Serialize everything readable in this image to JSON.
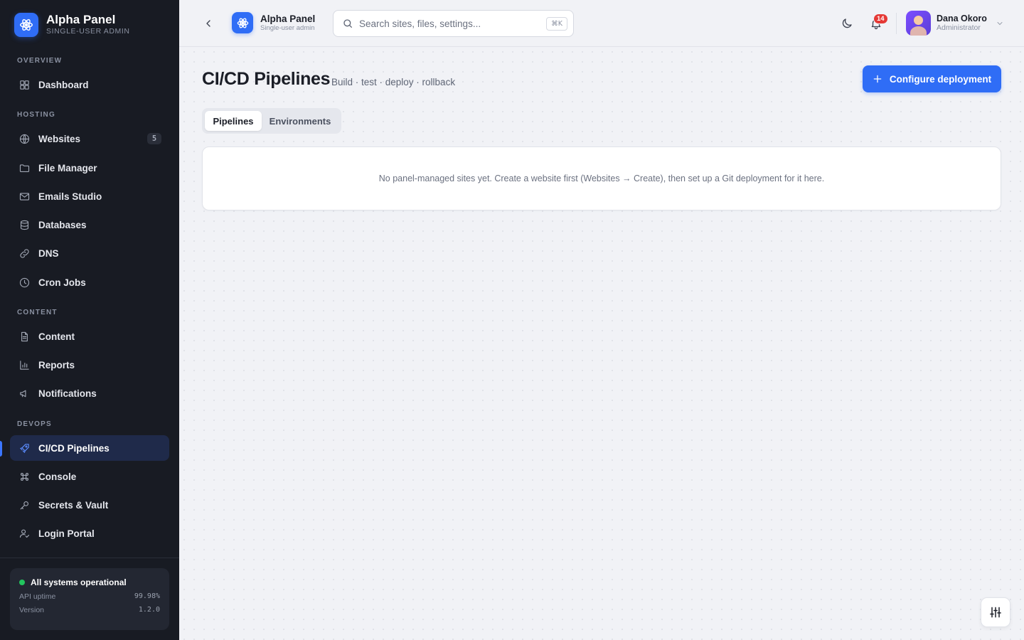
{
  "brand": {
    "title": "Alpha Panel",
    "subtitle": "SINGLE-USER ADMIN",
    "top_title": "Alpha Panel",
    "top_subtitle": "Single-user admin",
    "accent": "#2f6df6"
  },
  "sidebar": {
    "sections": {
      "overview": "OVERVIEW",
      "hosting": "HOSTING",
      "content": "CONTENT",
      "devops": "DEVOPS"
    },
    "items": [
      {
        "label": "Dashboard",
        "icon": "dashboard-icon"
      },
      {
        "label": "Websites",
        "icon": "globe-icon",
        "count": "5"
      },
      {
        "label": "File Manager",
        "icon": "folder-icon"
      },
      {
        "label": "Emails Studio",
        "icon": "mail-icon"
      },
      {
        "label": "Databases",
        "icon": "database-icon"
      },
      {
        "label": "DNS",
        "icon": "link-icon"
      },
      {
        "label": "Cron Jobs",
        "icon": "clock-icon"
      },
      {
        "label": "Content",
        "icon": "document-icon"
      },
      {
        "label": "Reports",
        "icon": "bar-chart-icon"
      },
      {
        "label": "Notifications",
        "icon": "megaphone-icon"
      },
      {
        "label": "CI/CD Pipelines",
        "icon": "rocket-icon",
        "active": true
      },
      {
        "label": "Console",
        "icon": "command-icon"
      },
      {
        "label": "Secrets & Vault",
        "icon": "key-icon"
      },
      {
        "label": "Login Portal",
        "icon": "user-check-icon"
      }
    ],
    "status": {
      "headline": "All systems operational",
      "uptime_label": "API uptime",
      "uptime_value": "99.98%",
      "version_label": "Version",
      "version_value": "1.2.0",
      "color": "#22c55e"
    }
  },
  "topbar": {
    "search_placeholder": "Search sites, files, settings...",
    "search_shortcut": "⌘K",
    "notifications_count": "14",
    "user": {
      "name": "Dana Okoro",
      "role": "Administrator"
    }
  },
  "page": {
    "title": "CI/CD Pipelines",
    "subtitle": "Build · test · deploy · rollback",
    "primary_action": "Configure deployment",
    "tabs": [
      {
        "label": "Pipelines",
        "selected": true
      },
      {
        "label": "Environments",
        "selected": false
      }
    ],
    "empty_message": "No panel-managed sites yet. Create a website first (Websites → Create), then set up a Git deployment for it here."
  }
}
